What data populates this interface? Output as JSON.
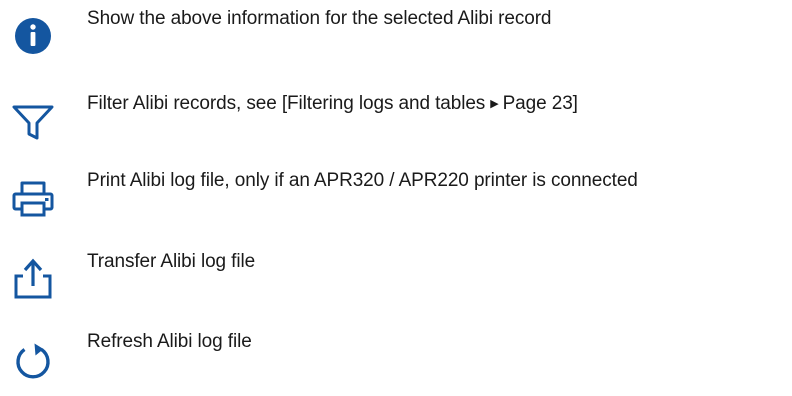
{
  "colors": {
    "icon_blue": "#1456a0",
    "text": "#1a1a1a"
  },
  "rows": [
    {
      "icon": "info-icon",
      "text": "Show the above information for the selected Alibi record"
    },
    {
      "icon": "filter-icon",
      "text_before_arrow": "Filter Alibi records, see [Filtering logs and tables",
      "arrow": "▶",
      "text_after_arrow": "Page 23]"
    },
    {
      "icon": "printer-icon",
      "text": "Print Alibi log file, only if an APR320 / APR220 printer is connected"
    },
    {
      "icon": "transfer-icon",
      "text": "Transfer Alibi log file"
    },
    {
      "icon": "refresh-icon",
      "text": "Refresh Alibi log file"
    }
  ]
}
